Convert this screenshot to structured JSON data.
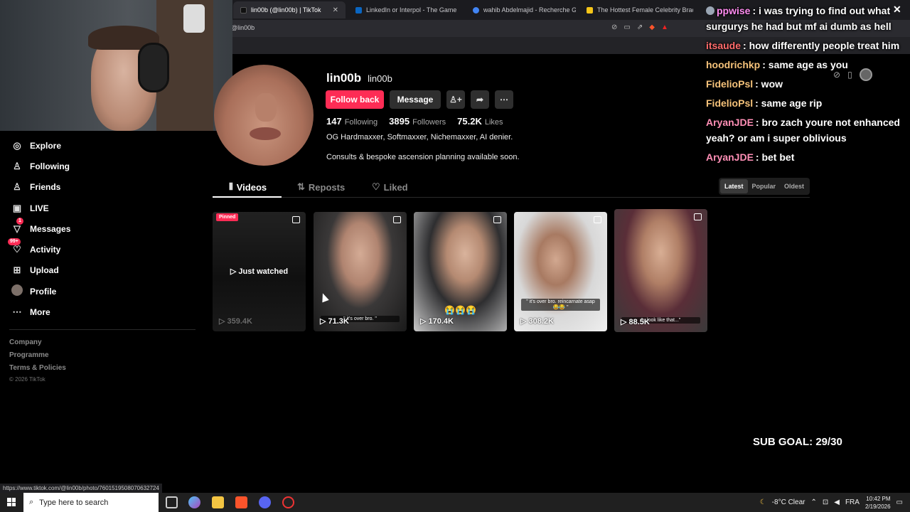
{
  "browser": {
    "tabs": [
      {
        "label": "lin00b (@lin00b) | TikTok",
        "active": true,
        "color": "#111111"
      },
      {
        "label": "LinkedIn or Interpol - The Game",
        "active": false,
        "color": "#0a66c2"
      },
      {
        "label": "wahib Abdelmajid - Recherche Goog",
        "active": false,
        "color": "#4285f4"
      },
      {
        "label": "The Hottest Female Celebrity Bracke",
        "active": false,
        "color": "#f5c518"
      }
    ],
    "url": "@lin00b",
    "status_url": "https://www.tiktok.com/@lin00b/photo/7601519508070632724"
  },
  "chat": {
    "messages": [
      {
        "user": "ppwise",
        "text": ": i was trying to find out what surgurys he had but mf ai dumb as hell",
        "color": "#ff8cf0"
      },
      {
        "user": "itsaude",
        "text": ": how differently people treat him",
        "color": "#ff6b6b"
      },
      {
        "user": "hoodrichkp",
        "text": ": same age as you",
        "color": "#f5c27a"
      },
      {
        "user": "FidelioPsl",
        "text": ": wow",
        "color": "#f5c27a"
      },
      {
        "user": "FidelioPsl",
        "text": ": same age rip",
        "color": "#f5c27a"
      },
      {
        "user": "AryanJDE",
        "text": ": bro zach youre not enhanced yeah? or am i super oblivious",
        "color": "#ff8fb6"
      },
      {
        "user": "AryanJDE",
        "text": ": bet bet",
        "color": "#ff8fb6"
      }
    ],
    "close": "✕"
  },
  "sidebar": {
    "items": [
      {
        "label": "Explore",
        "icon": "compass-icon",
        "glyph": "◎"
      },
      {
        "label": "Following",
        "icon": "person-icon",
        "glyph": "♙"
      },
      {
        "label": "Friends",
        "icon": "friends-icon",
        "glyph": "♙"
      },
      {
        "label": "LIVE",
        "icon": "live-icon",
        "glyph": "▣"
      },
      {
        "label": "Messages",
        "icon": "messages-icon",
        "glyph": "▽",
        "badge": "1"
      },
      {
        "label": "Activity",
        "icon": "activity-icon",
        "glyph": "♡",
        "badge": "99+"
      },
      {
        "label": "Upload",
        "icon": "upload-icon",
        "glyph": "⊞"
      },
      {
        "label": "Profile",
        "icon": "profile-avatar-icon",
        "glyph": ""
      },
      {
        "label": "More",
        "icon": "more-icon",
        "glyph": "⋯"
      }
    ],
    "footer": [
      "Company",
      "Programme",
      "Terms & Policies"
    ],
    "copyright": "© 2026 TikTok"
  },
  "profile": {
    "display_name": "lin00b",
    "handle": "lin00b",
    "follow_label": "Follow back",
    "message_label": "Message",
    "following_count": "147",
    "following_label": "Following",
    "followers_count": "3895",
    "followers_label": "Followers",
    "likes_count": "75.2K",
    "likes_label": "Likes",
    "bio_line1": "OG Hardmaxxer, Softmaxxer, Nichemaxxer, AI denier.",
    "bio_line2": "Consults & bespoke ascension planning available soon."
  },
  "tabs": {
    "videos": "Videos",
    "reposts": "Reposts",
    "liked": "Liked"
  },
  "sort": {
    "latest": "Latest",
    "popular": "Popular",
    "oldest": "Oldest"
  },
  "videos": [
    {
      "views": "359.4K",
      "pinned": "Pinned",
      "overlay": "Just watched",
      "caption": ""
    },
    {
      "views": "71.3K",
      "caption": "\" it's over bro. \""
    },
    {
      "views": "170.4K",
      "caption": "😭😭😭"
    },
    {
      "views": "308.2K",
      "caption": "\" it's over bro. reincarnate asap 😂😂 \""
    },
    {
      "views": "88.5K",
      "caption": "\"u look like that...\""
    }
  ],
  "overlay": {
    "sub_goal": "SUB GOAL: 29/30"
  },
  "taskbar": {
    "search_placeholder": "Type here to search",
    "weather": "-8°C  Clear",
    "lang": "FRA",
    "time": "10:42 PM",
    "date": "2/19/2026"
  }
}
